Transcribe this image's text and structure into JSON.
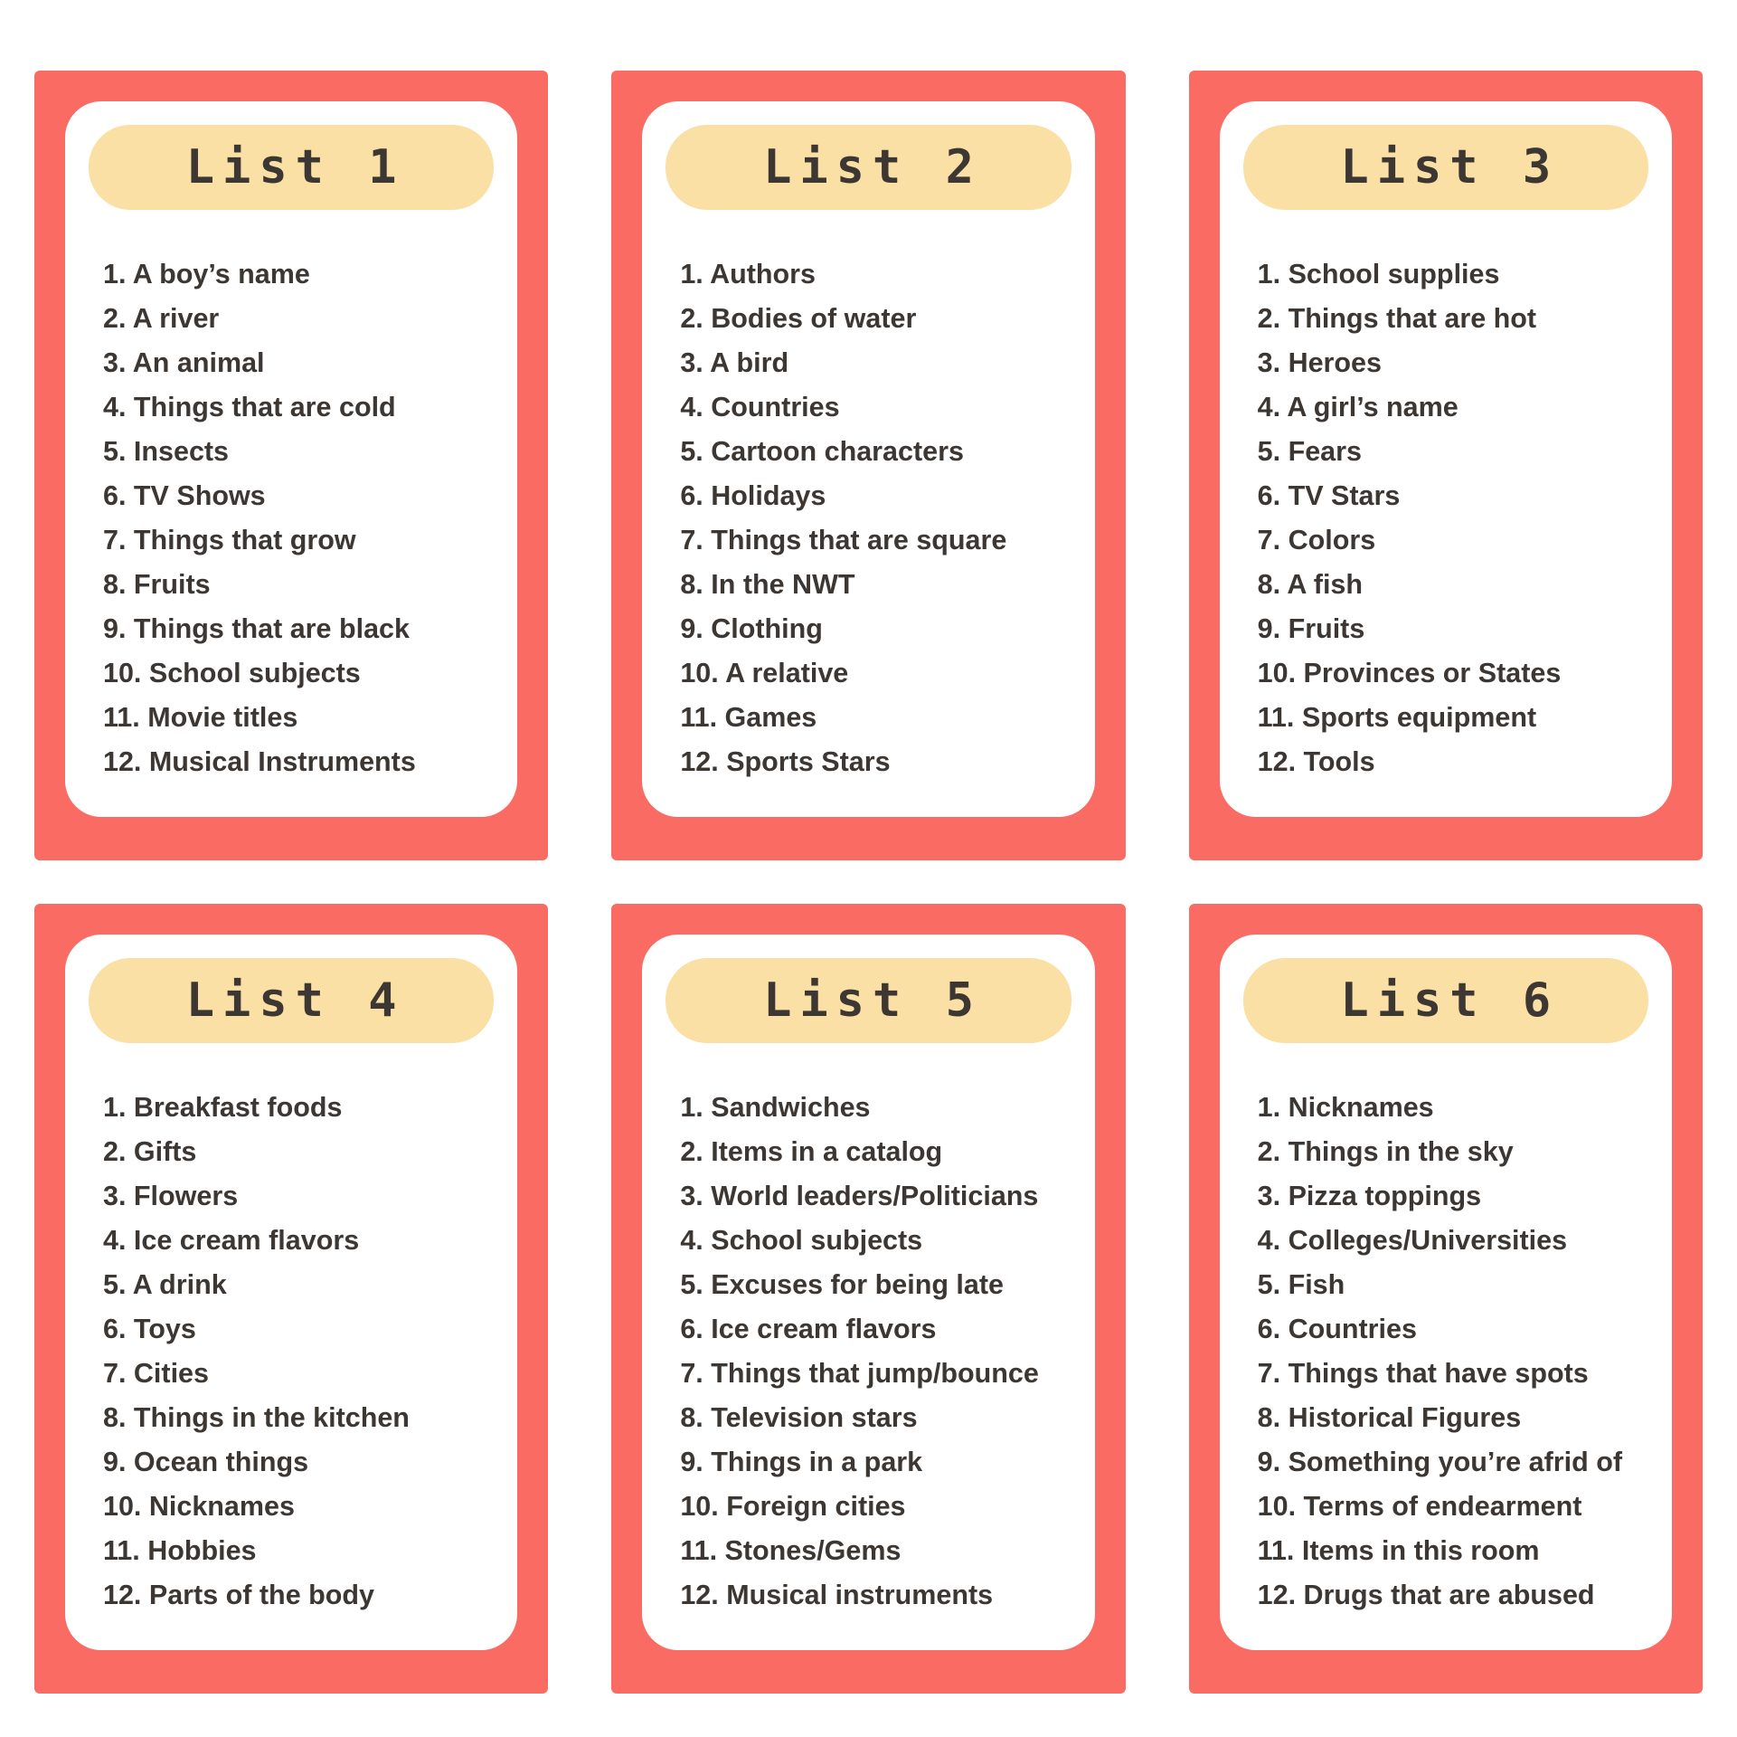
{
  "page": {
    "background_color": "#FFFFFF",
    "card_border_color": "#FA6B63",
    "card_inner_color": "#FFFFFF",
    "title_pill_color": "#FBE0A6",
    "text_color": "#3D3733"
  },
  "cards": [
    {
      "title": "List 1",
      "items": [
        "1. A boy’s name",
        "2. A river",
        "3. An animal",
        "4. Things that are cold",
        "5. Insects",
        "6. TV Shows",
        "7. Things that grow",
        "8. Fruits",
        "9. Things that are black",
        "10. School subjects",
        "11. Movie titles",
        "12. Musical Instruments"
      ]
    },
    {
      "title": "List 2",
      "items": [
        "1. Authors",
        "2. Bodies of water",
        "3. A bird",
        "4. Countries",
        "5. Cartoon characters",
        "6. Holidays",
        "7. Things that are square",
        "8. In the NWT",
        "9. Clothing",
        "10. A relative",
        "11. Games",
        "12. Sports Stars"
      ]
    },
    {
      "title": "List 3",
      "items": [
        "1. School supplies",
        "2. Things that are hot",
        "3. Heroes",
        "4. A girl’s name",
        "5. Fears",
        "6. TV Stars",
        "7. Colors",
        "8. A fish",
        "9. Fruits",
        "10. Provinces or States",
        "11. Sports equipment",
        "12. Tools"
      ]
    },
    {
      "title": "List 4",
      "items": [
        "1. Breakfast foods",
        "2. Gifts",
        "3. Flowers",
        "4. Ice cream flavors",
        "5. A drink",
        "6. Toys",
        "7. Cities",
        "8. Things in the kitchen",
        "9. Ocean things",
        "10. Nicknames",
        "11. Hobbies",
        "12. Parts of the body"
      ]
    },
    {
      "title": "List 5",
      "items": [
        "1. Sandwiches",
        "2. Items in a catalog",
        "3. World leaders/Politicians",
        "4. School subjects",
        "5. Excuses for being late",
        "6. Ice cream flavors",
        "7. Things that jump/bounce",
        "8. Television stars",
        "9. Things in a park",
        "10. Foreign cities",
        "11. Stones/Gems",
        "12. Musical instruments"
      ]
    },
    {
      "title": "List 6",
      "items": [
        "1. Nicknames",
        "2. Things in the sky",
        "3. Pizza toppings",
        "4. Colleges/Universities",
        "5. Fish",
        "6. Countries",
        "7. Things that have spots",
        "8. Historical Figures",
        "9. Something you’re afrid of",
        "10. Terms of endearment",
        "11. Items in this room",
        "12. Drugs that are abused"
      ]
    }
  ]
}
